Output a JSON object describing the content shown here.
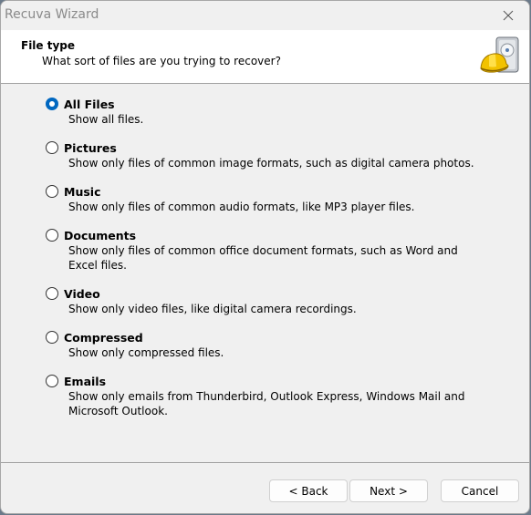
{
  "window": {
    "title": "Recuva Wizard",
    "close_icon": "close-icon"
  },
  "header": {
    "title": "File type",
    "subtitle": "What sort of files are you trying to recover?",
    "logo_icon": "recuva-hardhat-drive-icon"
  },
  "options": [
    {
      "label": "All Files",
      "description": "Show all files.",
      "checked": true
    },
    {
      "label": "Pictures",
      "description": "Show only files of common image formats, such as digital camera photos.",
      "checked": false
    },
    {
      "label": "Music",
      "description": "Show only files of common audio formats, like MP3 player files.",
      "checked": false
    },
    {
      "label": "Documents",
      "description": "Show only files of common office document formats, such as Word and Excel files.",
      "checked": false
    },
    {
      "label": "Video",
      "description": "Show only video files, like digital camera recordings.",
      "checked": false
    },
    {
      "label": "Compressed",
      "description": "Show only compressed files.",
      "checked": false
    },
    {
      "label": "Emails",
      "description": "Show only emails from Thunderbird, Outlook Express, Windows Mail and Microsoft Outlook.",
      "checked": false
    }
  ],
  "buttons": {
    "back": "< Back",
    "next": "Next >",
    "cancel": "Cancel"
  },
  "colors": {
    "accent": "#0067c0",
    "background": "#f0f0f0",
    "header_bg": "#ffffff"
  }
}
